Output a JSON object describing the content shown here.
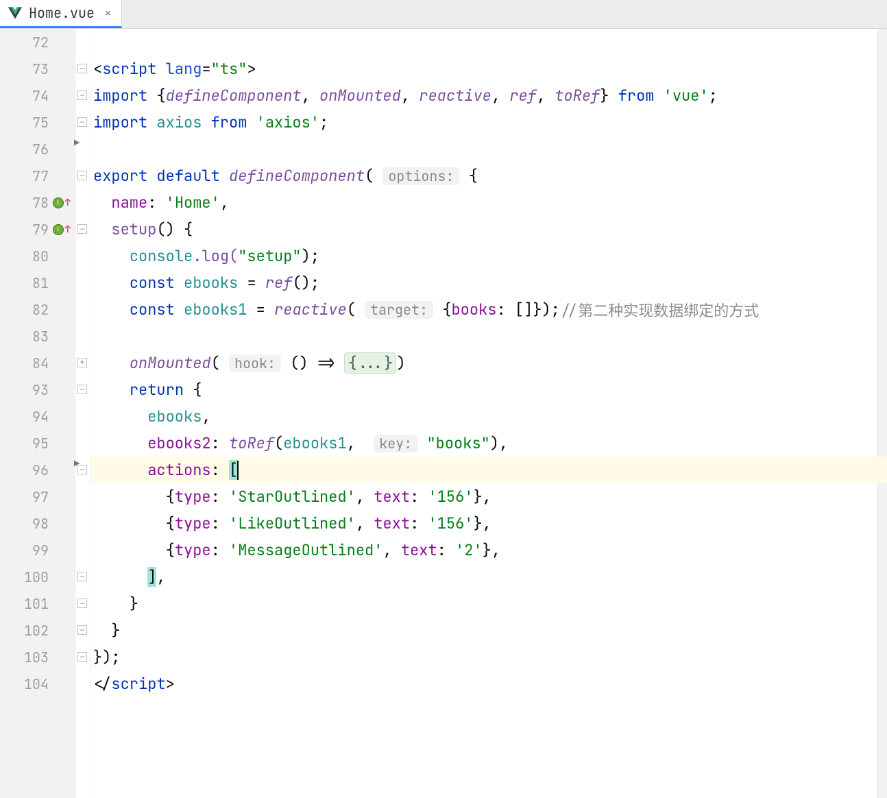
{
  "tab": {
    "filename": "Home.vue"
  },
  "lineNumbers": [
    "72",
    "73",
    "74",
    "75",
    "76",
    "77",
    "78",
    "79",
    "80",
    "81",
    "82",
    "83",
    "84",
    "93",
    "94",
    "95",
    "96",
    "97",
    "98",
    "99",
    "100",
    "101",
    "102",
    "103",
    "104"
  ],
  "hints": {
    "options": "options:",
    "target": "target:",
    "hook": "hook:",
    "key": "key:"
  },
  "foldedArrow": "{...}",
  "code": {
    "scriptOpen_tag": "script",
    "scriptOpen_attr": "lang",
    "scriptOpen_val": "\"ts\"",
    "importLine1_kw1": "import",
    "importLine1_braceL": "{",
    "importLine1_items": "defineComponent",
    "importLine1_c1": ", ",
    "importLine1_i2": "onMounted",
    "importLine1_c2": ", ",
    "importLine1_i3": "reactive",
    "importLine1_c3": ", ",
    "importLine1_i4": "ref",
    "importLine1_c4": ", ",
    "importLine1_i5": "toRef",
    "importLine1_braceR": "}",
    "importLine1_kw2": " from ",
    "importLine1_mod": "'vue'",
    "importLine1_semi": ";",
    "importLine2_kw1": "import",
    "importLine2_ident": " axios ",
    "importLine2_kw2": "from ",
    "importLine2_mod": "'axios'",
    "importLine2_semi": ";",
    "export_kw1": "export default",
    "export_fn": " defineComponent",
    "export_paren": "( ",
    "export_brace": " {",
    "name_key": "name",
    "name_colon": ": ",
    "name_val": "'Home'",
    "name_comma": ",",
    "setup_key": "setup",
    "setup_rest": "() {",
    "consoleLog_a": "console",
    "consoleLog_b": ".log(",
    "consoleLog_c": "\"setup\"",
    "consoleLog_d": ");",
    "const1_kw": "const",
    "const1_name": " ebooks ",
    "const1_eq": "= ",
    "const1_fn": "ref",
    "const1_rest": "();",
    "const2_kw": "const",
    "const2_name": " ebooks1 ",
    "const2_eq": "= ",
    "const2_fn": "reactive",
    "const2_paren": "( ",
    "const2_obj_a": " {",
    "const2_obj_key": "books",
    "const2_obj_b": ": []});",
    "const2_comment": "//第二种实现数据绑定的方式",
    "onMounted_fn": "onMounted",
    "onMounted_a": "( ",
    "onMounted_b": " () => ",
    "onMounted_c": ")",
    "return_kw": "return",
    "return_brace": " {",
    "ret1": "ebooks",
    "ret1_comma": ",",
    "ret2_key": "ebooks2",
    "ret2_colon": ": ",
    "ret2_fn": "toRef",
    "ret2_a": "(",
    "ret2_arg": "ebooks1",
    "ret2_b": ",  ",
    "ret2_c": " ",
    "ret2_str": "\"books\"",
    "ret2_d": "),",
    "actions_key": "actions",
    "actions_colon": ": ",
    "actions_open": "[",
    "row1_a": "{",
    "row1_k1": "type",
    "row1_b": ": ",
    "row1_v1": "'StarOutlined'",
    "row1_c": ", ",
    "row1_k2": "text",
    "row1_d": ": ",
    "row1_v2": "'156'",
    "row1_e": "},",
    "row2_a": "{",
    "row2_k1": "type",
    "row2_b": ": ",
    "row2_v1": "'LikeOutlined'",
    "row2_c": ", ",
    "row2_k2": "text",
    "row2_d": ": ",
    "row2_v2": "'156'",
    "row2_e": "},",
    "row3_a": "{",
    "row3_k1": "type",
    "row3_b": ": ",
    "row3_v1": "'MessageOutlined'",
    "row3_c": ", ",
    "row3_k2": "text",
    "row3_d": ": ",
    "row3_v2": "'2'",
    "row3_e": "},",
    "actions_close": "]",
    "actions_comma": ",",
    "closeBrace1": "}",
    "closeBrace2": "}",
    "closeAll": "});",
    "scriptClose_a": "</",
    "scriptClose_b": "script",
    "scriptClose_c": ">"
  }
}
